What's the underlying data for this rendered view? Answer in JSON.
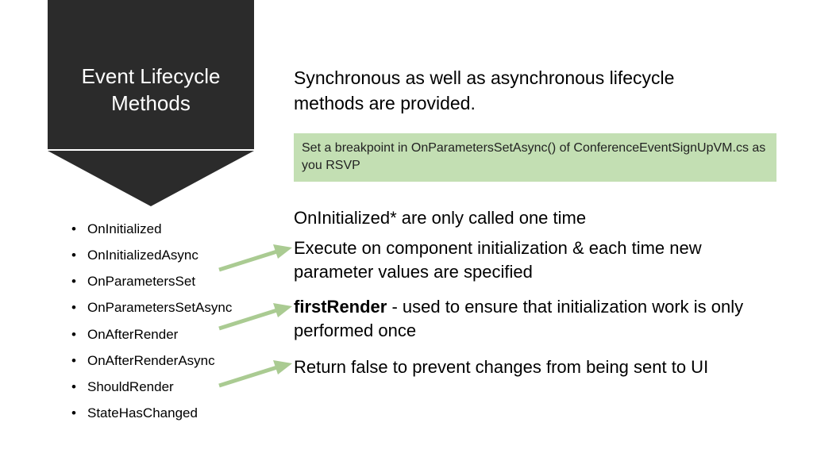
{
  "banner": {
    "title": "Event Lifecycle Methods"
  },
  "intro": "Synchronous as well as asynchronous lifecycle methods are provided.",
  "callout": "Set a breakpoint in OnParametersSetAsync() of ConferenceEventSignUpVM.cs as you RSVP",
  "methods": [
    "OnInitialized",
    "OnInitializedAsync",
    "OnParametersSet",
    "OnParametersSetAsync",
    "OnAfterRender",
    "OnAfterRenderAsync",
    "ShouldRender",
    "StateHasChanged"
  ],
  "descriptions": {
    "d1": "OnInitialized* are only called one time",
    "d2": "Execute on component initialization & each time new parameter values are specified",
    "d3_bold": "firstRender",
    "d3_rest": " - used to ensure that initialization work is only performed once",
    "d4": "Return false to prevent changes from being sent to UI"
  },
  "colors": {
    "banner_bg": "#2b2b2b",
    "callout_bg": "#c3dfb3",
    "arrow": "#aacb92"
  }
}
